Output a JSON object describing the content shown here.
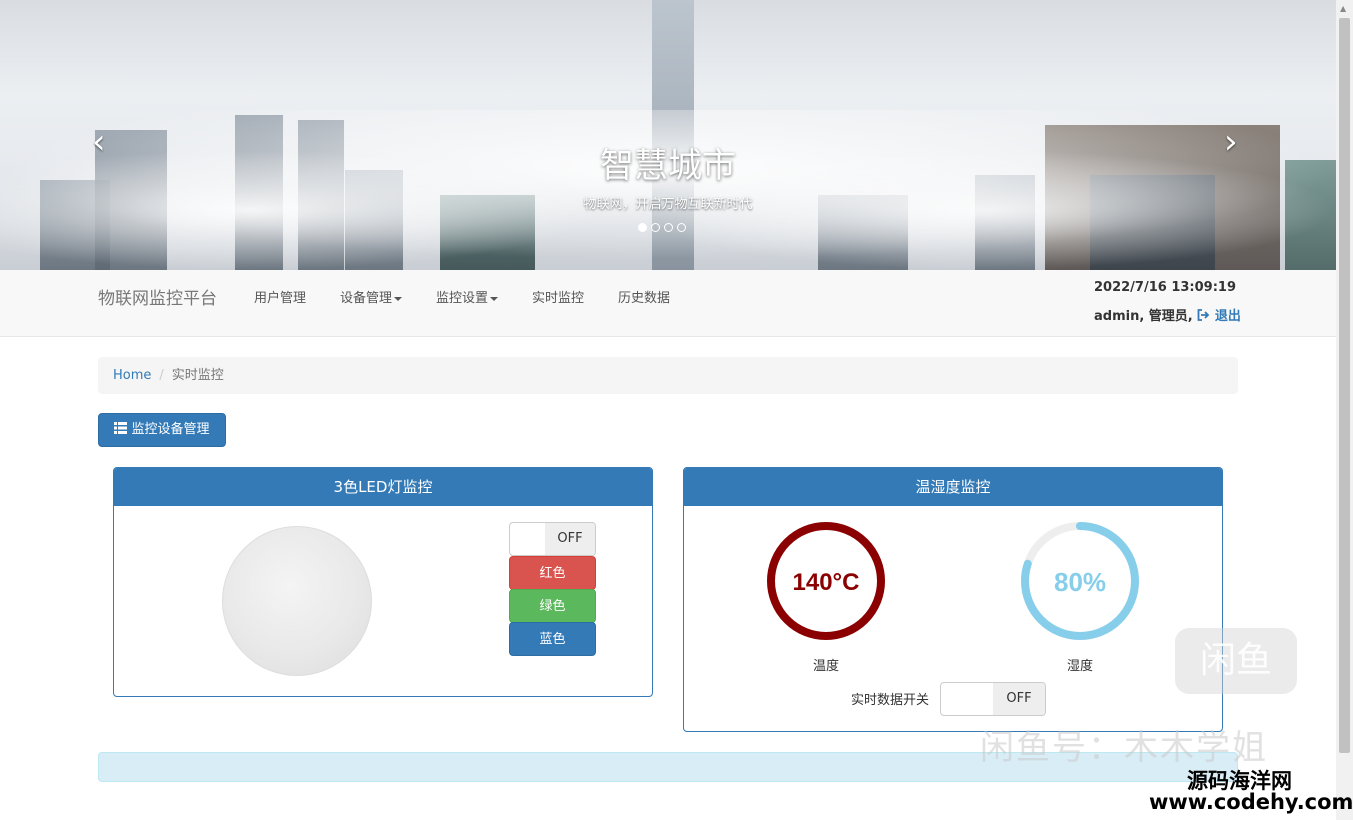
{
  "banner": {
    "title": "智慧城市",
    "subtitle": "物联网，开启万物互联新时代",
    "prev_arrow": "‹",
    "next_arrow": "›",
    "slide_count": 4,
    "active_slide": 1
  },
  "navbar": {
    "brand": "物联网监控平台",
    "items": [
      {
        "label": "用户管理",
        "dropdown": false
      },
      {
        "label": "设备管理",
        "dropdown": true
      },
      {
        "label": "监控设置",
        "dropdown": true
      },
      {
        "label": "实时监控",
        "dropdown": false
      },
      {
        "label": "历史数据",
        "dropdown": false
      }
    ],
    "datetime": "2022/7/16 13:09:19",
    "user": "admin, 管理员,",
    "logout_label": "退出"
  },
  "breadcrumb": {
    "home": "Home",
    "separator": "/",
    "current": "实时监控"
  },
  "manage_button": {
    "label": "监控设备管理",
    "icon": "th-list-icon"
  },
  "led_panel": {
    "title": "3色LED灯监控",
    "toggle_label": "OFF",
    "buttons": [
      "红色",
      "绿色",
      "蓝色"
    ]
  },
  "env_panel": {
    "title": "温湿度监控",
    "temperature": {
      "value_text": "140°C",
      "label": "温度",
      "fraction": 1.0,
      "color": "#8b0000"
    },
    "humidity": {
      "value_text": "80%",
      "label": "湿度",
      "fraction": 0.8,
      "color": "#87ceeb"
    },
    "switch_label": "实时数据开关",
    "switch_state": "OFF"
  },
  "watermarks": {
    "xianyu": "闲鱼号：木木学姐",
    "logo": "闲鱼",
    "site_name": "源码海洋网",
    "site_url": "www.codehy.com"
  },
  "colors": {
    "primary": "#337ab7",
    "danger": "#d9534f",
    "success": "#5cb85c",
    "info_bg": "#d9edf7"
  }
}
